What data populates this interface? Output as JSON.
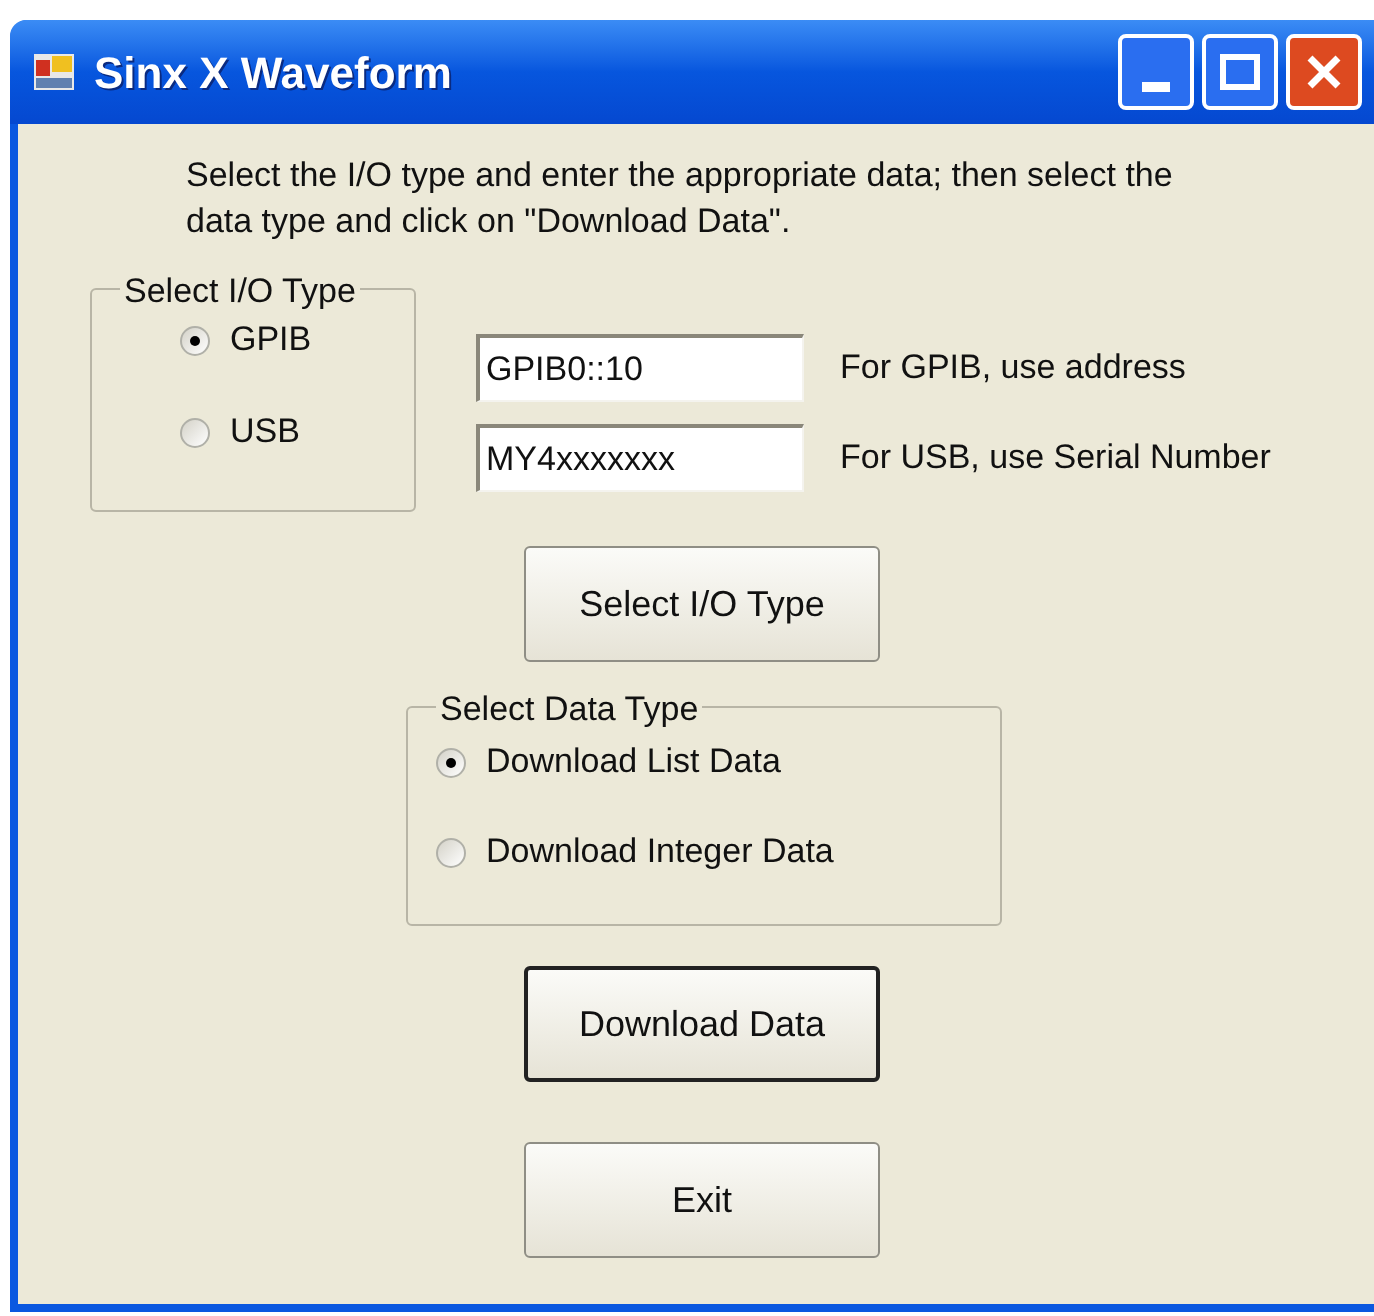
{
  "window": {
    "title": "Sinx X Waveform"
  },
  "instructions": "Select the I/O type and enter the appropriate data; then select the data type and click on \"Download Data\".",
  "io_type": {
    "title": "Select I/O Type",
    "options": [
      {
        "label": "GPIB",
        "selected": true,
        "value": "GPIB0::10",
        "hint": "For GPIB, use address"
      },
      {
        "label": "USB",
        "selected": false,
        "value": "MY4xxxxxxx",
        "hint": "For USB, use Serial Number"
      }
    ]
  },
  "select_button": "Select I/O Type",
  "data_type": {
    "title": "Select Data Type",
    "options": [
      {
        "label": "Download List Data",
        "selected": true
      },
      {
        "label": "Download Integer Data",
        "selected": false
      }
    ]
  },
  "download_button": {
    "label": "Download Data",
    "focused": true
  },
  "exit_button": "Exit"
}
